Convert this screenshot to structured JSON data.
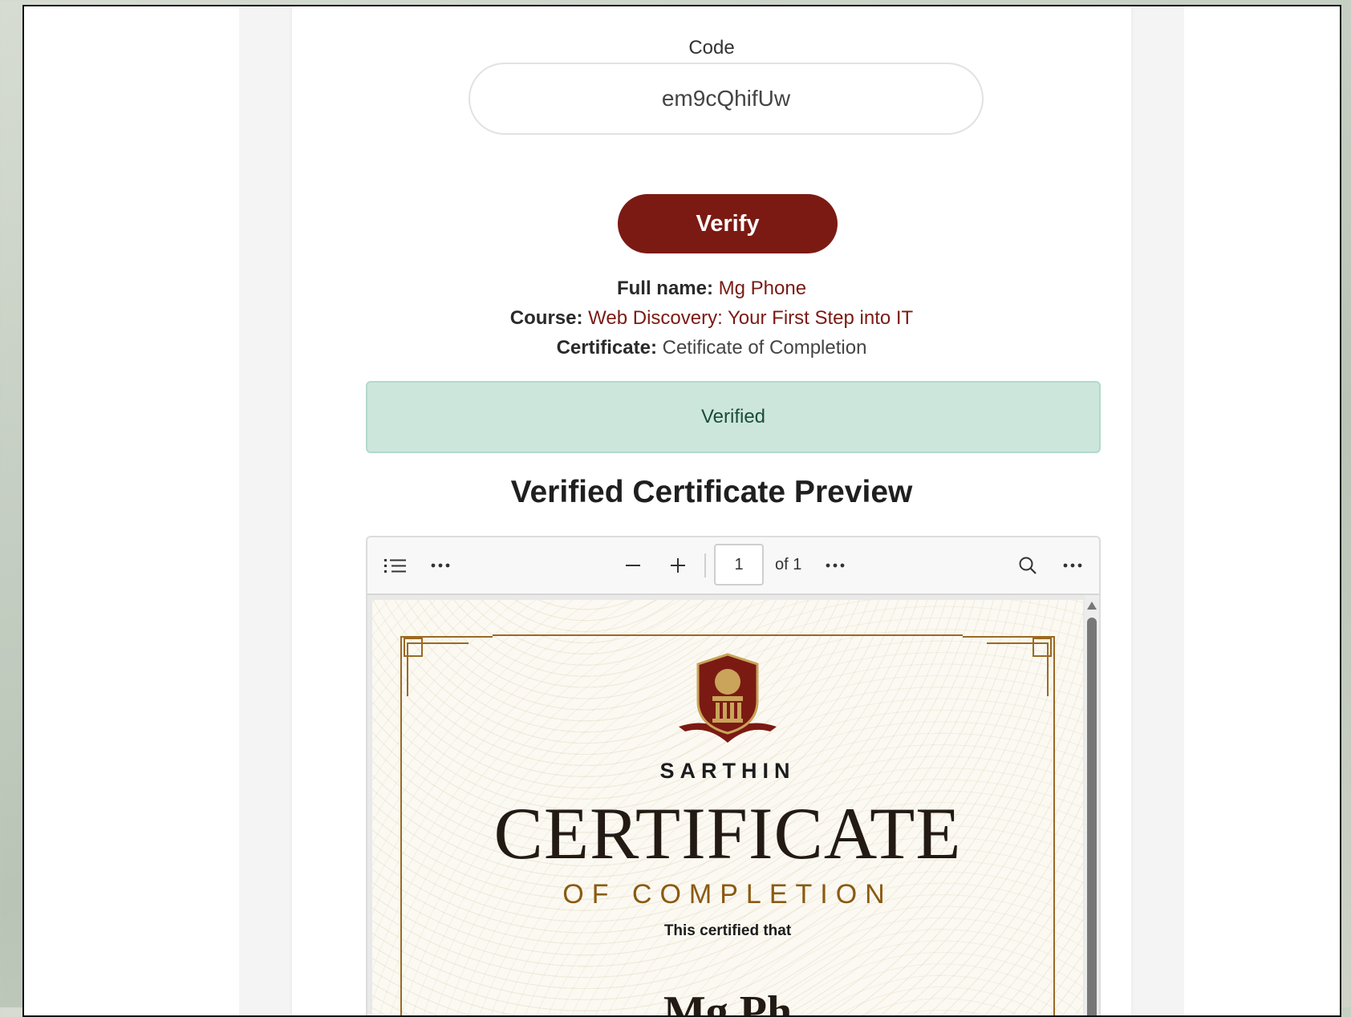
{
  "form": {
    "code_label": "Code",
    "code_value": "em9cQhifUw",
    "verify_label": "Verify"
  },
  "result": {
    "full_name_label": "Full name:",
    "full_name_value": "Mg Phone",
    "course_label": "Course:",
    "course_value": "Web Discovery: Your First Step into IT",
    "certificate_label": "Certificate:",
    "certificate_value": "Cetificate of Completion",
    "status": "Verified"
  },
  "preview": {
    "title": "Verified Certificate Preview",
    "viewer": {
      "page_number": "1",
      "page_total": "of 1"
    },
    "certificate": {
      "brand": "SARTHIN",
      "title": "CERTIFICATE",
      "subtitle": "OF COMPLETION",
      "body": "This certified that",
      "recipient_partial": "Mg Ph"
    }
  },
  "colors": {
    "accent": "#7b1a13",
    "success_bg": "#cde6dc",
    "gold": "#8a5a12"
  }
}
